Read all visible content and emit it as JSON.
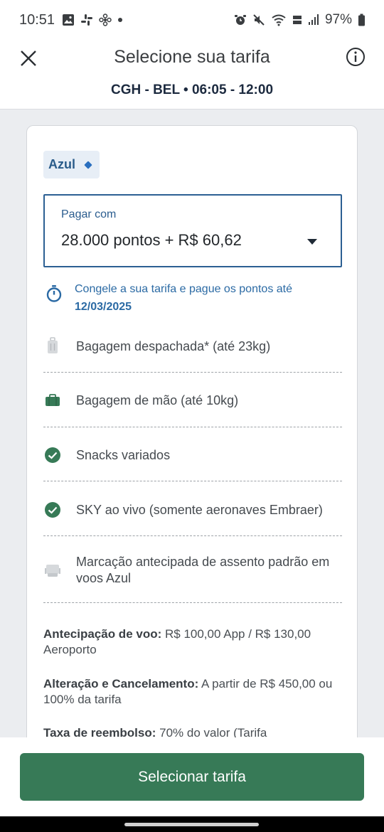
{
  "status_bar": {
    "time": "10:51",
    "battery": "97%"
  },
  "header": {
    "title": "Selecione sua tarifa",
    "route": "CGH - BEL • 06:05 - 12:00"
  },
  "fare": {
    "brand": "Azul",
    "pay_with_label": "Pagar com",
    "pay_with_value": "28.000 pontos + R$ 60,62",
    "freeze_text": "Congele a sua tarifa e pague os pontos até",
    "freeze_date": "12/03/2025",
    "features": [
      {
        "label": "Bagagem despachada* (até 23kg)",
        "icon": "suitcase-icon",
        "included": false
      },
      {
        "label": "Bagagem de mão (até 10kg)",
        "icon": "briefcase-icon",
        "included": true
      },
      {
        "label": "Snacks variados",
        "icon": "check-circle-icon",
        "included": true
      },
      {
        "label": "SKY ao vivo (somente aeronaves Embraer)",
        "icon": "check-circle-icon",
        "included": true
      },
      {
        "label": "Marcação antecipada de assento padrão em voos Azul",
        "icon": "seat-icon",
        "included": false
      }
    ],
    "policies": [
      {
        "title": "Antecipação de voo:",
        "text": " R$ 100,00 App / R$ 130,00 Aeroporto"
      },
      {
        "title": "Alteração e Cancelamento:",
        "text": " A partir de R$ 450,00 ou 100% da tarifa"
      },
      {
        "title": "Taxa de reembolso:",
        "text": " 70% do valor (Tarifa"
      }
    ]
  },
  "cta_label": "Selecionar tarifa",
  "colors": {
    "primary_green": "#377a57",
    "brand_blue": "#2c5f93"
  }
}
